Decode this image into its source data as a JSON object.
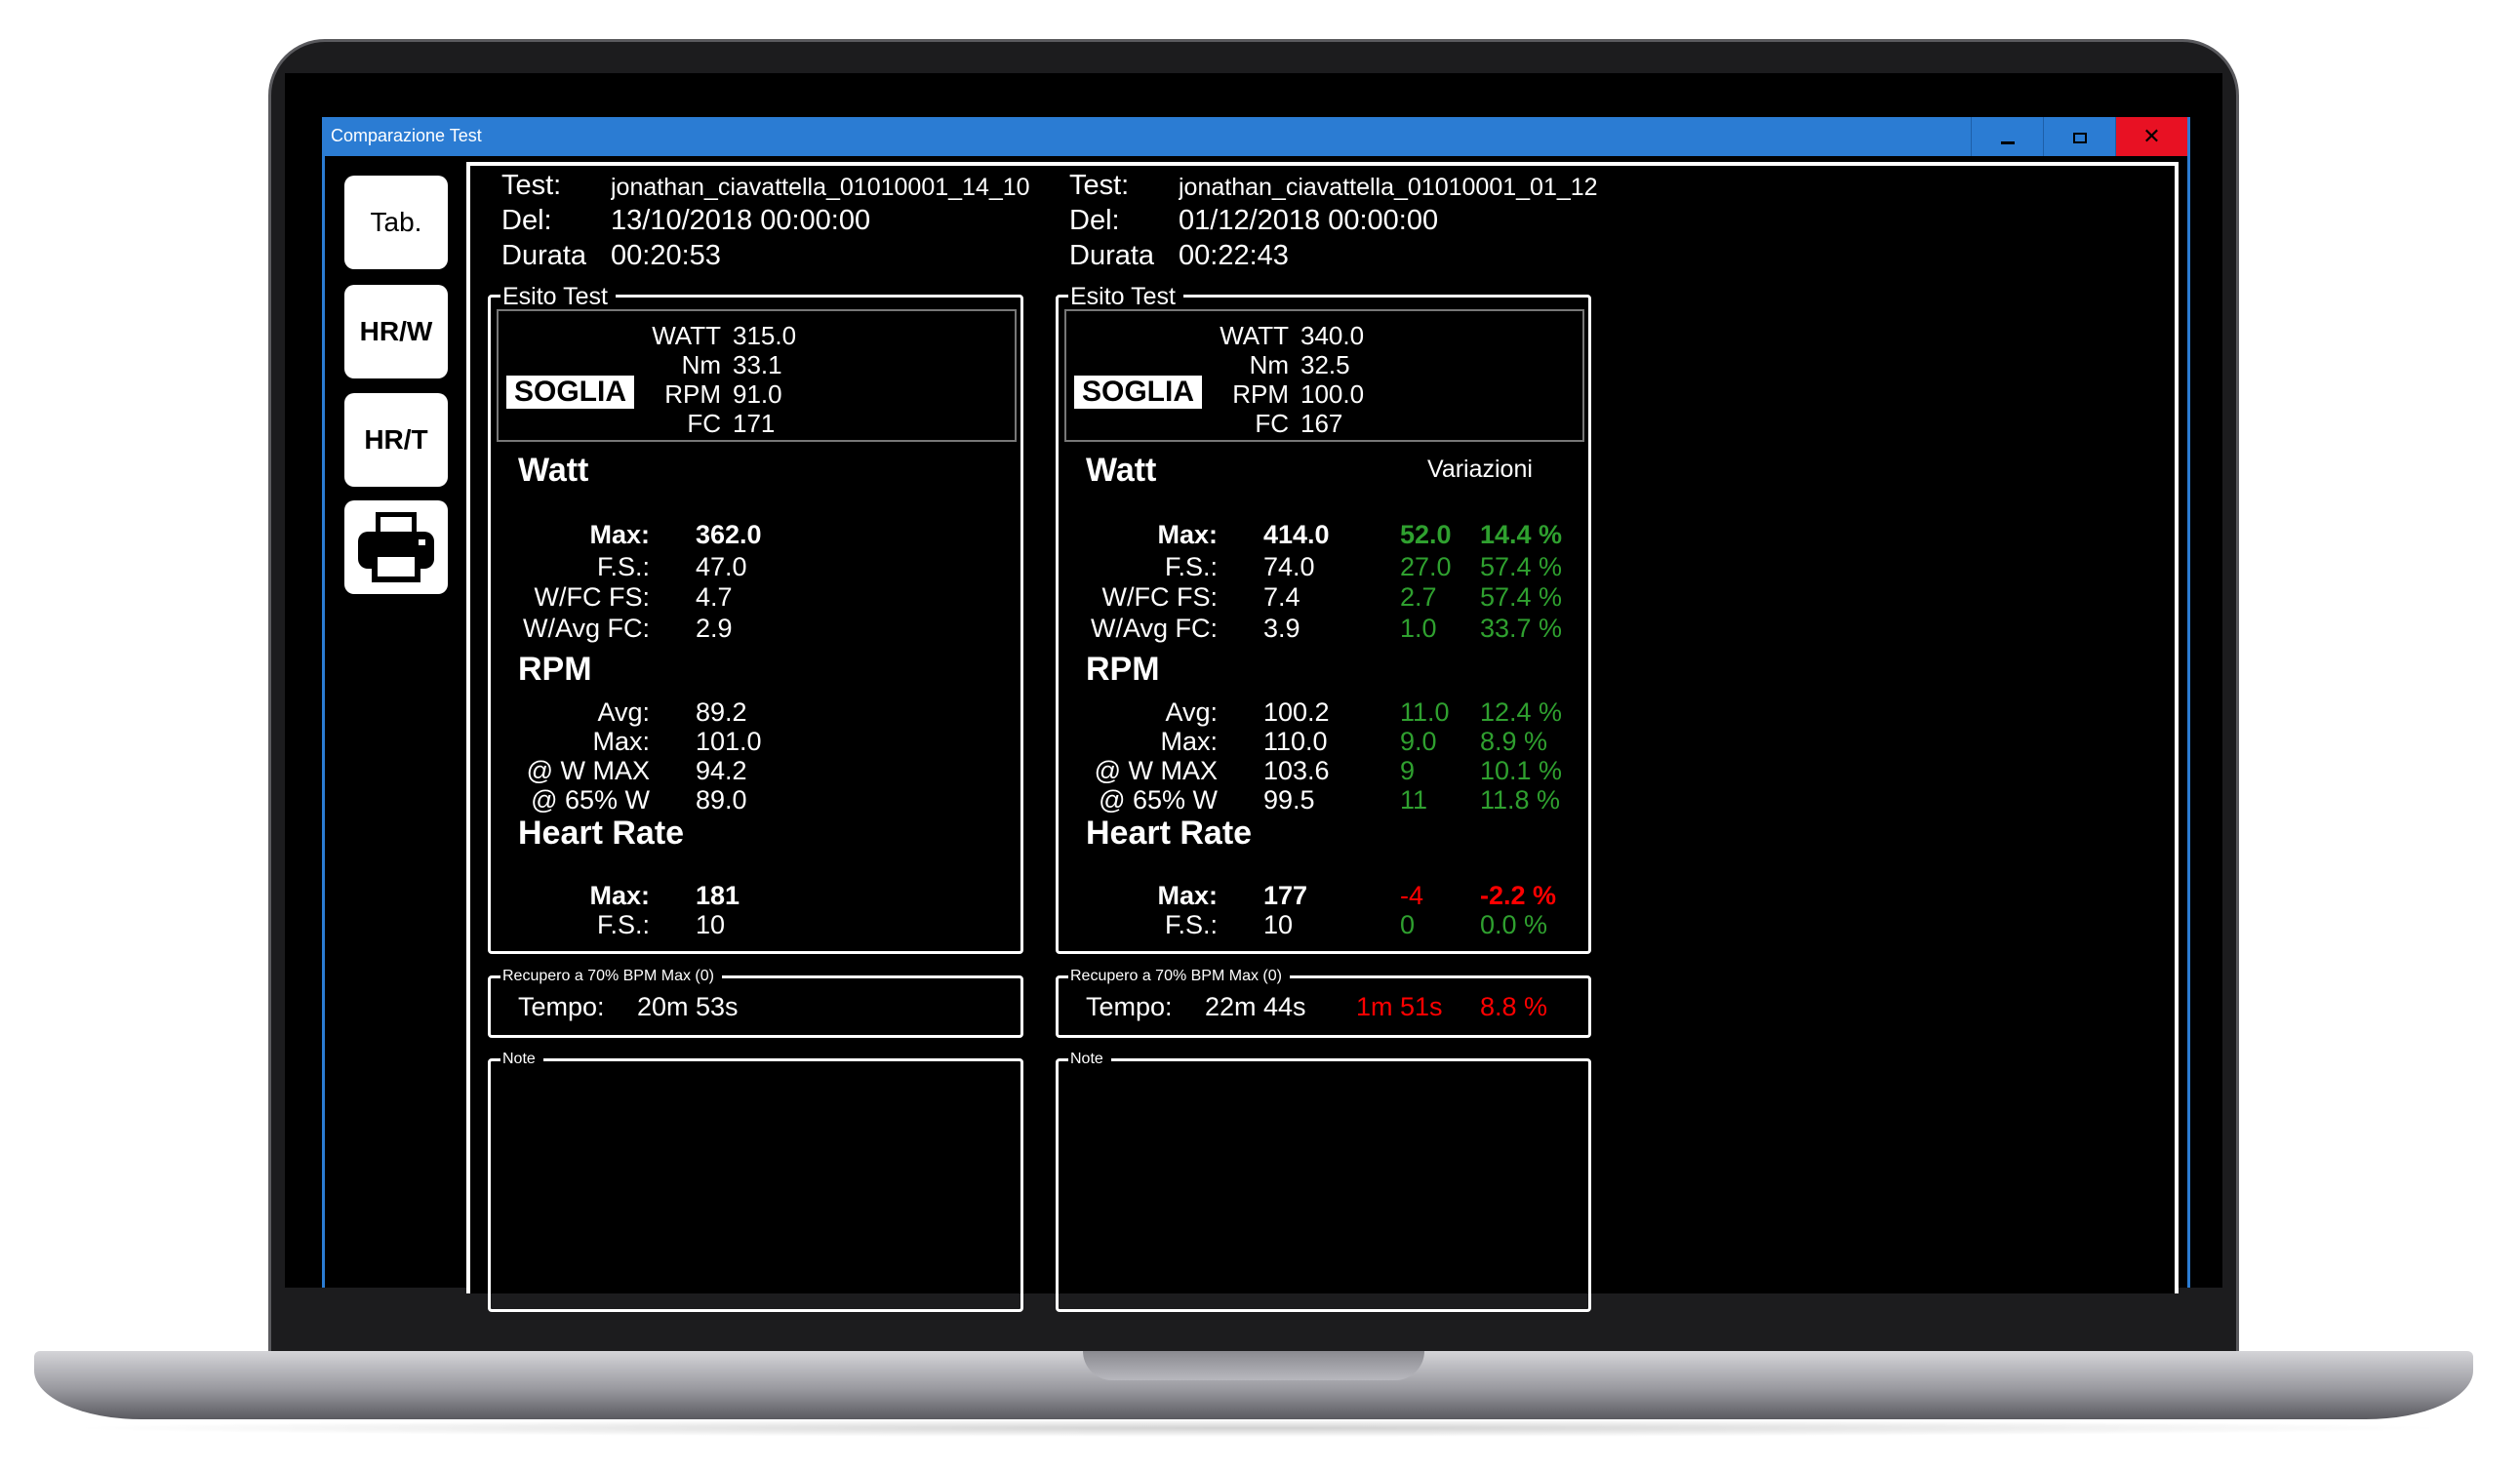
{
  "window": {
    "title": "Comparazione Test",
    "minimize_label": "",
    "close_label": "✕"
  },
  "sidebar": {
    "tab_label": "Tab.",
    "hrw_label": "HR/W",
    "hrt_label": "HR/T"
  },
  "labels": {
    "test": "Test:",
    "del": "Del:",
    "durata": "Durata",
    "esito_test": "Esito Test",
    "soglia": "SOGLIA",
    "watt_k": "WATT",
    "nm_k": "Nm",
    "rpm_k": "RPM",
    "fc_k": "FC",
    "watt_section": "Watt",
    "rpm_section": "RPM",
    "hr_section": "Heart Rate",
    "max": "Max:",
    "fs": "F.S.:",
    "wfc_fs": "W/FC FS:",
    "wavg_fc": "W/Avg FC:",
    "avg": "Avg:",
    "at_wmax": "@ W MAX",
    "at_65": "@ 65% W",
    "recupero": "Recupero a 70% BPM Max (0)",
    "tempo": "Tempo:",
    "note": "Note",
    "variazioni": "Variazioni"
  },
  "test1": {
    "name": "jonathan_ciavattella_01010001_14_10",
    "date": "13/10/2018 00:00:00",
    "duration": "00:20:53",
    "soglia": {
      "watt": "315.0",
      "nm": "33.1",
      "rpm": "91.0",
      "fc": "171"
    },
    "watt": {
      "max": "362.0",
      "fs": "47.0",
      "wfc_fs": "4.7",
      "wavg_fc": "2.9"
    },
    "rpm": {
      "avg": "89.2",
      "max": "101.0",
      "at_wmax": "94.2",
      "at_65": "89.0"
    },
    "hr": {
      "max": "181",
      "fs": "10"
    },
    "tempo": "20m 53s"
  },
  "test2": {
    "name": "jonathan_ciavattella_01010001_01_12",
    "date": "01/12/2018 00:00:00",
    "duration": "00:22:43",
    "soglia": {
      "watt": "340.0",
      "nm": "32.5",
      "rpm": "100.0",
      "fc": "167"
    },
    "watt": {
      "max": "414.0",
      "fs": "74.0",
      "wfc_fs": "7.4",
      "wavg_fc": "3.9"
    },
    "rpm": {
      "avg": "100.2",
      "max": "110.0",
      "at_wmax": "103.6",
      "at_65": "99.5"
    },
    "hr": {
      "max": "177",
      "fs": "10"
    },
    "tempo": "22m 44s"
  },
  "variations": {
    "watt_max": {
      "abs": "52.0",
      "pct": "14.4 %"
    },
    "watt_fs": {
      "abs": "27.0",
      "pct": "57.4 %"
    },
    "watt_wfc": {
      "abs": "2.7",
      "pct": "57.4 %"
    },
    "watt_wavg": {
      "abs": "1.0",
      "pct": "33.7 %"
    },
    "rpm_avg": {
      "abs": "11.0",
      "pct": "12.4 %"
    },
    "rpm_max": {
      "abs": "9.0",
      "pct": "8.9 %"
    },
    "rpm_wmax": {
      "abs": "9",
      "pct": "10.1 %"
    },
    "rpm_65": {
      "abs": "11",
      "pct": "11.8 %"
    },
    "hr_max": {
      "abs": "-4",
      "pct": "-2.2 %"
    },
    "hr_fs": {
      "abs": "0",
      "pct": "0.0 %"
    },
    "tempo": {
      "abs": "1m 51s",
      "pct": "8.8 %"
    }
  },
  "colors": {
    "accent": "#2b7cd3",
    "positive": "#2fa02f",
    "negative": "#ff0000"
  }
}
